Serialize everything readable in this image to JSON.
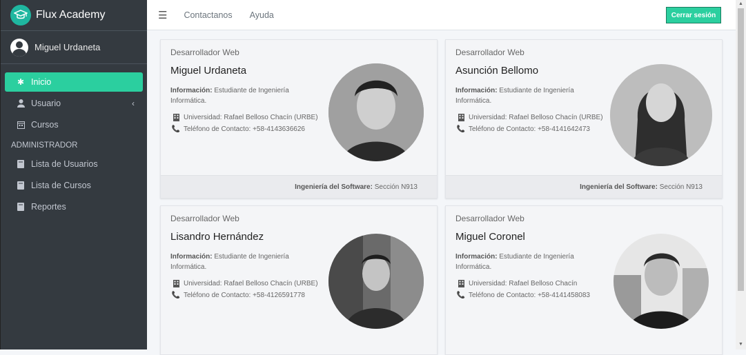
{
  "app": {
    "name": "Flux Academy"
  },
  "user": {
    "name": "Miguel Urdaneta"
  },
  "sidebar": {
    "items": [
      {
        "label": "Inicio"
      },
      {
        "label": "Usuario"
      },
      {
        "label": "Cursos"
      }
    ],
    "admin_header": "ADMINISTRADOR",
    "admin_items": [
      {
        "label": "Lista de Usuarios"
      },
      {
        "label": "Lista de Cursos"
      },
      {
        "label": "Reportes"
      }
    ]
  },
  "topbar": {
    "links": [
      "Contactanos",
      "Ayuda"
    ],
    "logout": "Cerrar sesión"
  },
  "cards": [
    {
      "role": "Desarrollador Web",
      "name": "Miguel Urdaneta",
      "info_label": "Información:",
      "info_text": "Estudiante de Ingeniería Informática.",
      "uni_text": "Universidad: Rafael Belloso Chacín (URBE)",
      "phone_text": "Teléfono de Contacto: +58-4143636626",
      "footer_label": "Ingeniería del Software:",
      "footer_text": "Sección N913"
    },
    {
      "role": "Desarrollador Web",
      "name": "Asunción Bellomo",
      "info_label": "Información:",
      "info_text": "Estudiante de Ingeniería Informática.",
      "uni_text": "Universidad: Rafael Belloso Chacín (URBE)",
      "phone_text": "Teléfono de Contacto: +58-4141642473",
      "footer_label": "Ingeniería del Software:",
      "footer_text": "Sección N913"
    },
    {
      "role": "Desarrollador Web",
      "name": "Lisandro Hernández",
      "info_label": "Información:",
      "info_text": "Estudiante de Ingeniería Informática.",
      "uni_text": "Universidad: Rafael Belloso Chacín (URBE)",
      "phone_text": "Teléfono de Contacto: +58-4126591778"
    },
    {
      "role": "Desarrollador Web",
      "name": "Miguel Coronel",
      "info_label": "Información:",
      "info_text": "Estudiante de Ingeniería Informática.",
      "uni_text": "Universidad: Rafael Belloso Chacín",
      "phone_text": "Teléfono de Contacto: +58-4141458083"
    }
  ],
  "colors": {
    "accent": "#2bcf9f",
    "sidebar": "#343a40",
    "background": "#f4f6f9"
  }
}
